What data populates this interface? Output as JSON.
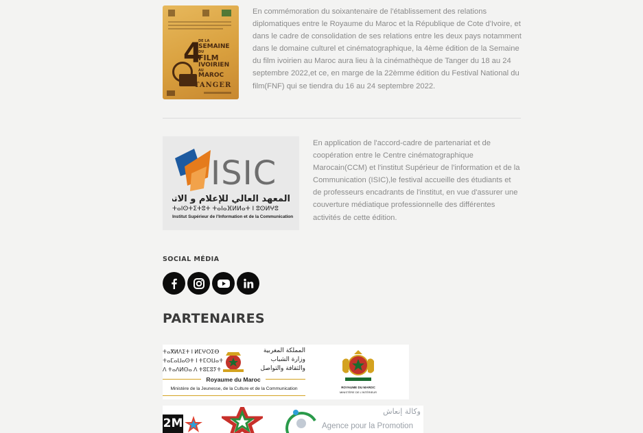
{
  "sections": {
    "poster_item": {
      "poster": {
        "week_label_1": "DE LA",
        "week_label_2": "SEMAINE",
        "week_label_3": "DU",
        "week_label_4": "FILM",
        "week_label_5": "IVOIRIEN",
        "week_label_6": "AU",
        "week_label_7": "MAROC",
        "edition_number": "4",
        "city": "TANGER"
      },
      "text": "En commémoration du soixantenaire de l'établissement des relations diplomatiques entre le Royaume du Maroc et la République de Cote d'Ivoire, et dans le cadre de consolidation de ses relations entre les deux pays notamment dans le domaine culturel et cinématographique, la 4ème édition de la Semaine du film ivoirien au Maroc aura lieu à la cinémathèque de Tanger du 18 au 24 septembre 2022,et ce, en marge de la 22èmme édition du Festival National du film(FNF) qui se tiendra du 16 au 24 septembre 2022."
    },
    "isic_item": {
      "logo": {
        "brand": "ISIC",
        "arabic": "المعهد العالي للإعلام و الاتصال",
        "tifinagh": "ⵜⴰⵏⵙⵜⵉⵜⵓⵜ ⵜⴰⵏⴰⴼⵍⵍⴰⵜ ⵏ ⵓⵙⵍⵖⵓ",
        "french": "Institut Supérieur de l'Information et de la Communication"
      },
      "text": "En application de l'accord-cadre de partenariat et de coopération entre le Centre cinématographique Marocain(CCM) et l'institut Supérieur de l'information et de la Communication (ISIC),le festival accueille des étudiants et de professeurs encadrants de l'institut, en vue d'assurer une couverture médiatique professionnelle des différentes activités de cette édition."
    }
  },
  "social": {
    "title": "SOCIAL MÉDIA",
    "icons": [
      "facebook-icon",
      "instagram-icon",
      "youtube-icon",
      "linkedin-icon"
    ]
  },
  "partners": {
    "title": "PARTENAIRES",
    "ministry": {
      "tifinagh_1": "ⵜⴰⴳⵍⴷⵉⵜ ⵏ ⵍⵎⵖⵔⵉⴱ",
      "tifinagh_2": "ⵜⴰⵎⴰⵡⴰⵙⵜ ⵏ ⵜⵎⵔⵡⴰⵜ",
      "tifinagh_3": "ⴷ ⵜⴰⴷⵍⵙⴰ ⴷ ⵜⵓⵎⵓⵢⵜ",
      "arabic_1": "المملكة المغربية",
      "arabic_2": "وزارة الشباب",
      "arabic_3": "والثقافة والتواصل",
      "title": "Royaume du Maroc",
      "subtitle": "Ministère de la Jeunesse, de la Culture et de la Communication"
    },
    "interior": {
      "line1": "ROYAUME DU MAROC",
      "line2": "MINISTÈRE DE L'INTÉRIEUR"
    },
    "row2": {
      "tv_label": "2M",
      "agency_arabic": "وكالة إنعاش",
      "agency_french": "Agence pour la Promotion"
    }
  },
  "colors": {
    "text": "#8a8a8a",
    "heading": "#3a3a3a",
    "social_bg": "#0c0c0c",
    "isic_orange": "#e57b1c",
    "isic_blue": "#1d5aa0"
  }
}
